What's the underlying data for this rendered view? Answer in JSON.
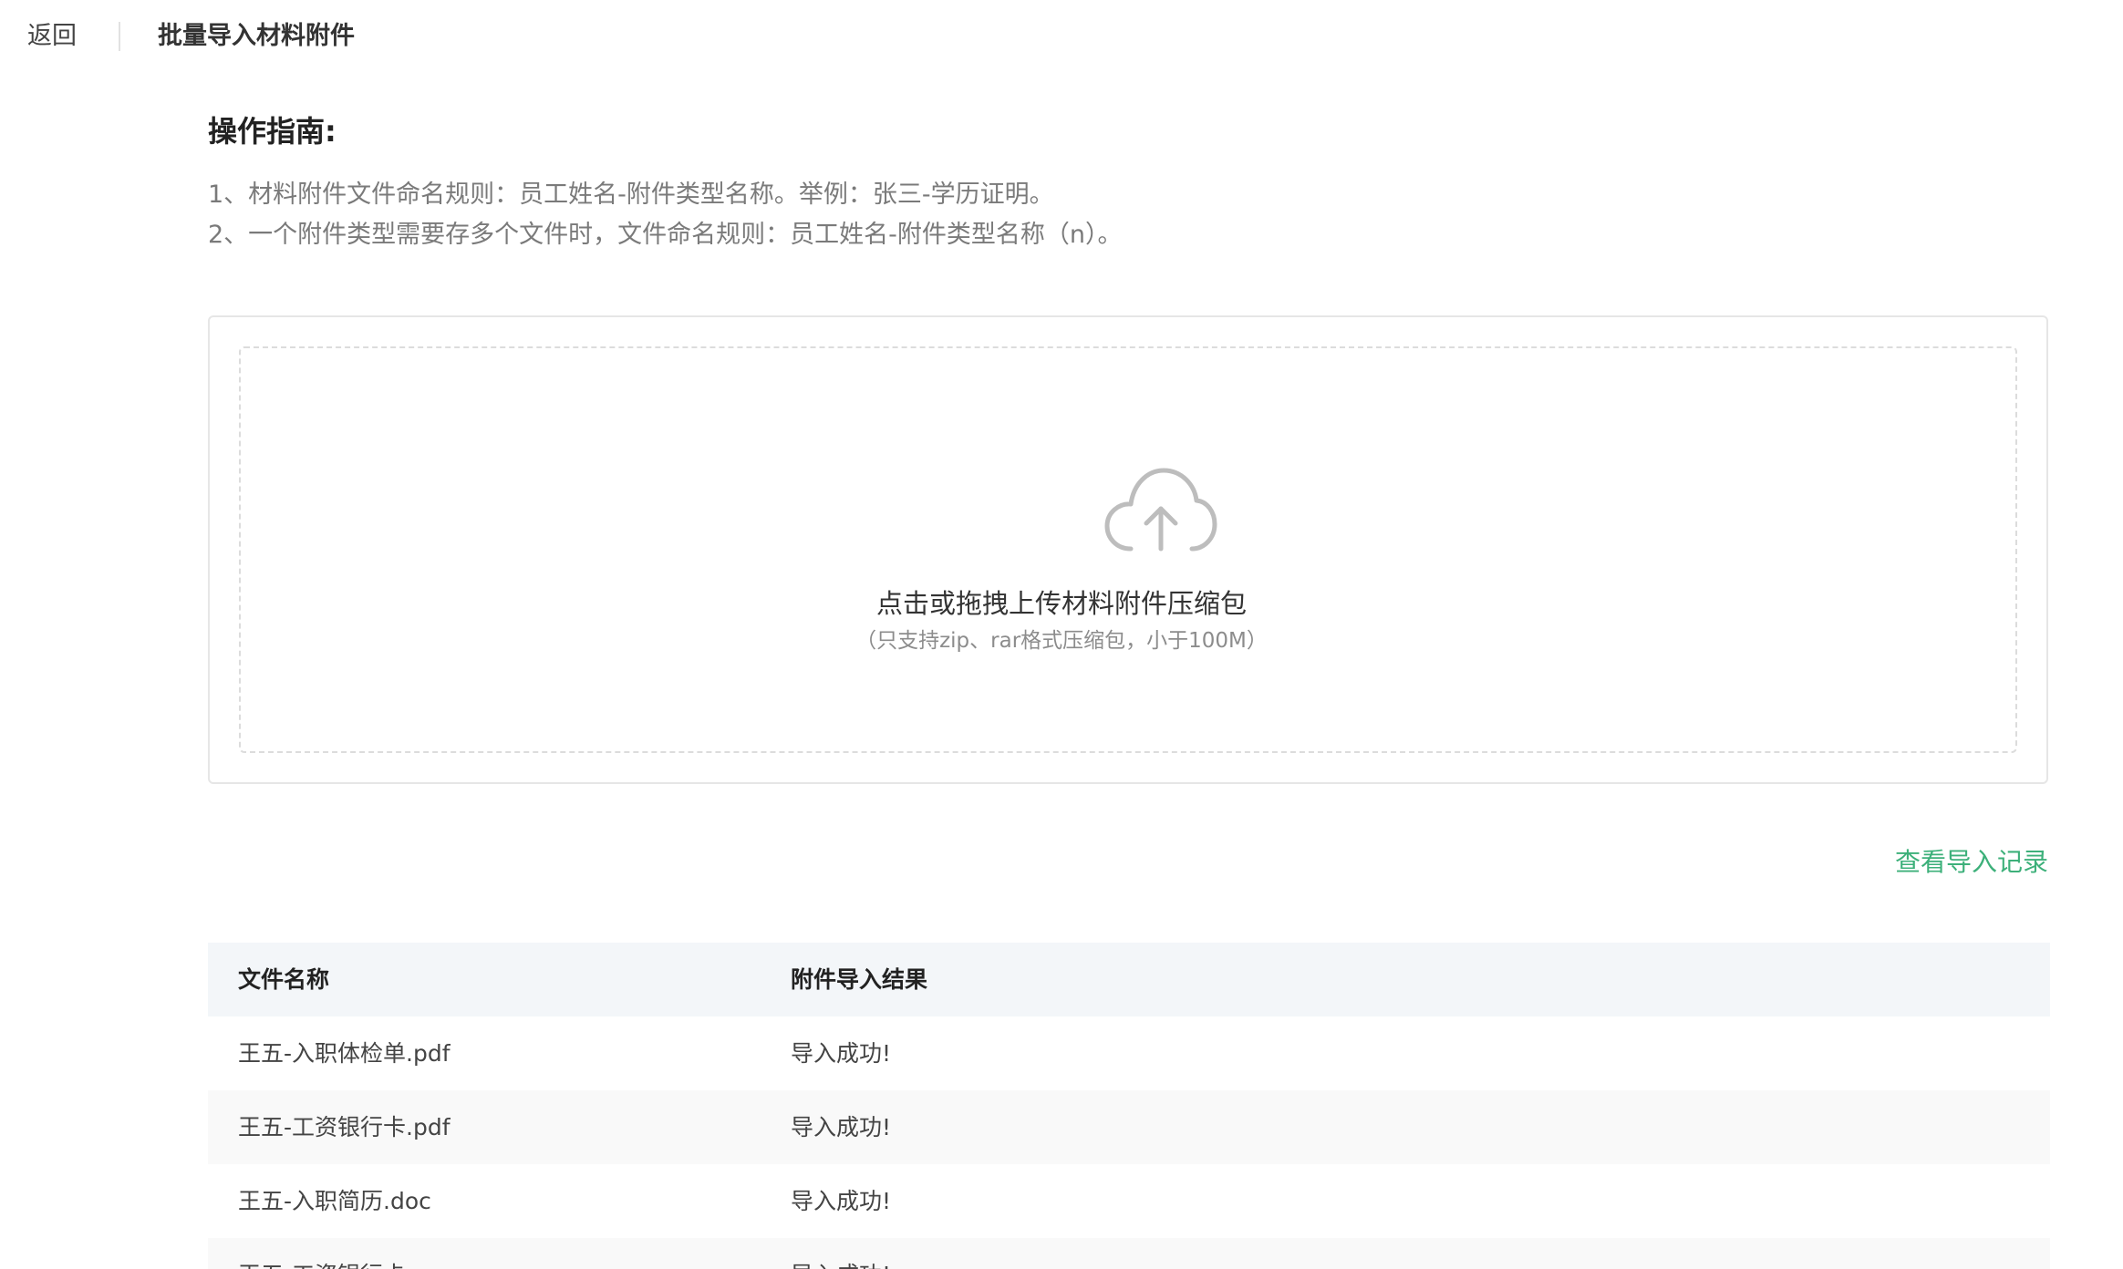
{
  "header": {
    "back_label": "返回",
    "title": "批量导入材料附件"
  },
  "guide": {
    "title": "操作指南:",
    "lines": [
      "1、材料附件文件命名规则：员工姓名-附件类型名称。举例：张三-学历证明。",
      "2、一个附件类型需要存多个文件时，文件命名规则：员工姓名-附件类型名称（n）。"
    ]
  },
  "upload": {
    "icon": "cloud-upload-icon",
    "title": "点击或拖拽上传材料附件压缩包",
    "hint": "（只支持zip、rar格式压缩包，小于100M）"
  },
  "view_records_label": "查看导入记录",
  "table": {
    "columns": [
      "文件名称",
      "附件导入结果"
    ],
    "rows": [
      {
        "name": "王五-入职体检单.pdf",
        "result": "导入成功!"
      },
      {
        "name": "王五-工资银行卡.pdf",
        "result": "导入成功!"
      },
      {
        "name": "王五-入职简历.doc",
        "result": "导入成功!"
      },
      {
        "name": "王五-工资银行卡.png",
        "result": "导入成功!"
      }
    ]
  },
  "colors": {
    "accent": "#3db07a",
    "table_header_bg": "#f3f6f9"
  }
}
